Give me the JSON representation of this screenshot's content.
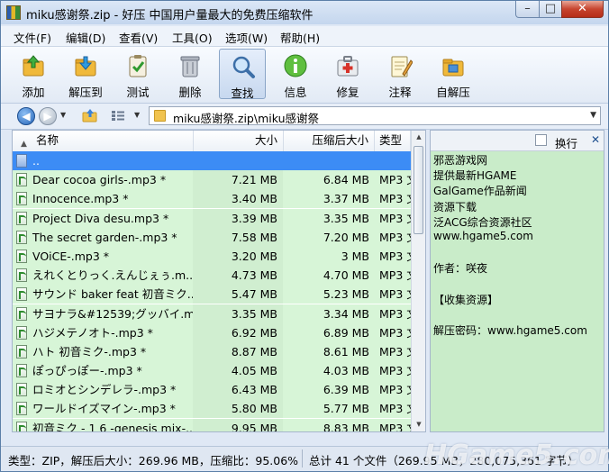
{
  "window": {
    "title": "miku感谢祭.zip - 好压 中国用户量最大的免费压缩软件",
    "min": "–",
    "max": "□",
    "close": "✕"
  },
  "menu": [
    "文件(F)",
    "编辑(D)",
    "查看(V)",
    "工具(O)",
    "选项(W)",
    "帮助(H)"
  ],
  "toolbar": [
    {
      "label": "添加",
      "icon": "add-archive-icon"
    },
    {
      "label": "解压到",
      "icon": "extract-to-icon"
    },
    {
      "label": "测试",
      "icon": "test-clipboard-icon"
    },
    {
      "label": "删除",
      "icon": "trash-icon"
    },
    {
      "label": "查找",
      "icon": "magnifier-icon"
    },
    {
      "label": "信息",
      "icon": "info-icon"
    },
    {
      "label": "修复",
      "icon": "repair-kit-icon"
    },
    {
      "label": "注释",
      "icon": "comment-notepad-icon"
    },
    {
      "label": "自解压",
      "icon": "self-extract-icon"
    }
  ],
  "address": {
    "path": "miku感谢祭.zip\\miku感谢祭"
  },
  "columns": {
    "name": "名称",
    "size": "大小",
    "compressed": "压缩后大小",
    "type": "类型"
  },
  "files": [
    {
      "name": "..",
      "size": "",
      "compressed": "",
      "type": "",
      "selected": true
    },
    {
      "name": "Dear cocoa girls-.mp3 *",
      "size": "7.21 MB",
      "compressed": "6.84 MB",
      "type": "MP3 文"
    },
    {
      "name": "Innocence.mp3 *",
      "size": "3.40 MB",
      "compressed": "3.37 MB",
      "type": "MP3 文"
    },
    {
      "name": "Project Diva desu.mp3 *",
      "size": "3.39 MB",
      "compressed": "3.35 MB",
      "type": "MP3 文"
    },
    {
      "name": "The secret garden-.mp3 *",
      "size": "7.58 MB",
      "compressed": "7.20 MB",
      "type": "MP3 文"
    },
    {
      "name": "VOiCE-.mp3 *",
      "size": "3.20 MB",
      "compressed": "3 MB",
      "type": "MP3 文"
    },
    {
      "name": "えれくとりっく.えんじぇぅ.m...",
      "size": "4.73 MB",
      "compressed": "4.70 MB",
      "type": "MP3 文"
    },
    {
      "name": "サウンド baker feat 初音ミク...",
      "size": "5.47 MB",
      "compressed": "5.23 MB",
      "type": "MP3 文"
    },
    {
      "name": "サヨナラ&#12539;グッバイ.m...",
      "size": "3.35 MB",
      "compressed": "3.34 MB",
      "type": "MP3 文"
    },
    {
      "name": "ハジメテノオト-.mp3 *",
      "size": "6.92 MB",
      "compressed": "6.89 MB",
      "type": "MP3 文"
    },
    {
      "name": "ハト 初音ミク-.mp3 *",
      "size": "8.87 MB",
      "compressed": "8.61 MB",
      "type": "MP3 文"
    },
    {
      "name": "ぽっぴっぽー-.mp3 *",
      "size": "4.05 MB",
      "compressed": "4.03 MB",
      "type": "MP3 文"
    },
    {
      "name": "ロミオとシンデレラ-.mp3 *",
      "size": "6.43 MB",
      "compressed": "6.39 MB",
      "type": "MP3 文"
    },
    {
      "name": "ワールドイズマイン-.mp3 *",
      "size": "5.80 MB",
      "compressed": "5.77 MB",
      "type": "MP3 文"
    },
    {
      "name": "初音ミク - 1 6 -genesis mix-...",
      "size": "9.95 MB",
      "compressed": "8.83 MB",
      "type": "MP3 文"
    }
  ],
  "comment": {
    "wrap_label": "换行",
    "lines": [
      "邪恶游戏网",
      "提供最新HGAME",
      "GalGame作品新闻",
      "资源下载",
      "泛ACG综合资源社区",
      "www.hgame5.com",
      "",
      "作者：咲夜",
      "",
      "【收集资源】",
      "",
      "解压密码：www.hgame5.com"
    ]
  },
  "status": {
    "left": "类型：ZIP，解压后大小：269.96 MB，压缩比：95.06%",
    "right": "总计 41 个文件（269.95 MB，280,075,361 字节）"
  },
  "watermark": "HGame5.com"
}
